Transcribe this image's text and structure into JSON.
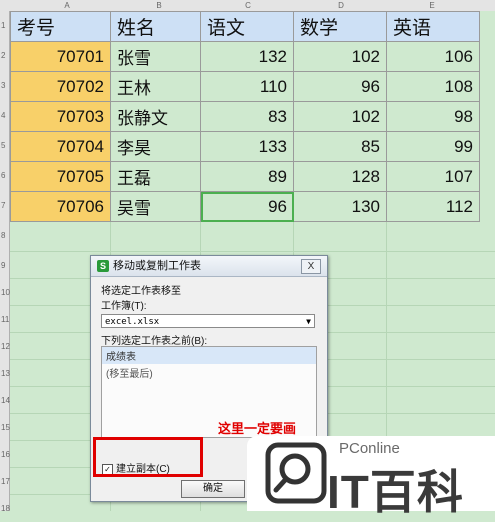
{
  "columns": [
    "A",
    "B",
    "C",
    "D",
    "E"
  ],
  "rows": [
    "1",
    "2",
    "3",
    "4",
    "5",
    "6",
    "7",
    "8",
    "9",
    "10",
    "11",
    "12",
    "13",
    "14",
    "15",
    "16",
    "17",
    "18"
  ],
  "headers": [
    "考号",
    "姓名",
    "语文",
    "数学",
    "英语"
  ],
  "table": [
    [
      "70701",
      "张雪",
      "132",
      "102",
      "106"
    ],
    [
      "70702",
      "王林",
      "110",
      "96",
      "108"
    ],
    [
      "70703",
      "张静文",
      "83",
      "102",
      "98"
    ],
    [
      "70704",
      "李昊",
      "133",
      "85",
      "99"
    ],
    [
      "70705",
      "王磊",
      "89",
      "128",
      "107"
    ],
    [
      "70706",
      "吴雪",
      "96",
      "130",
      "112"
    ]
  ],
  "dialog": {
    "logo": "S",
    "title": "移动或复制工作表",
    "close": "X",
    "move_label": "将选定工作表移至",
    "workbook_label": "工作簿(T):",
    "workbook_value": "excel.xlsx",
    "before_label": "下列选定工作表之前(B):",
    "sheets": [
      "成绩表",
      "(移至最后)"
    ],
    "copy_checkbox": "建立副本(C)",
    "ok": "确定"
  },
  "annotation": "这里一定要画",
  "watermark": {
    "top": "PConline",
    "brand": "IT百科"
  },
  "colors": {
    "header_fill": "#cde0f5",
    "id_fill": "#f8d069",
    "sheet_bg": "#cfe9cf",
    "annotation": "#e00000"
  }
}
